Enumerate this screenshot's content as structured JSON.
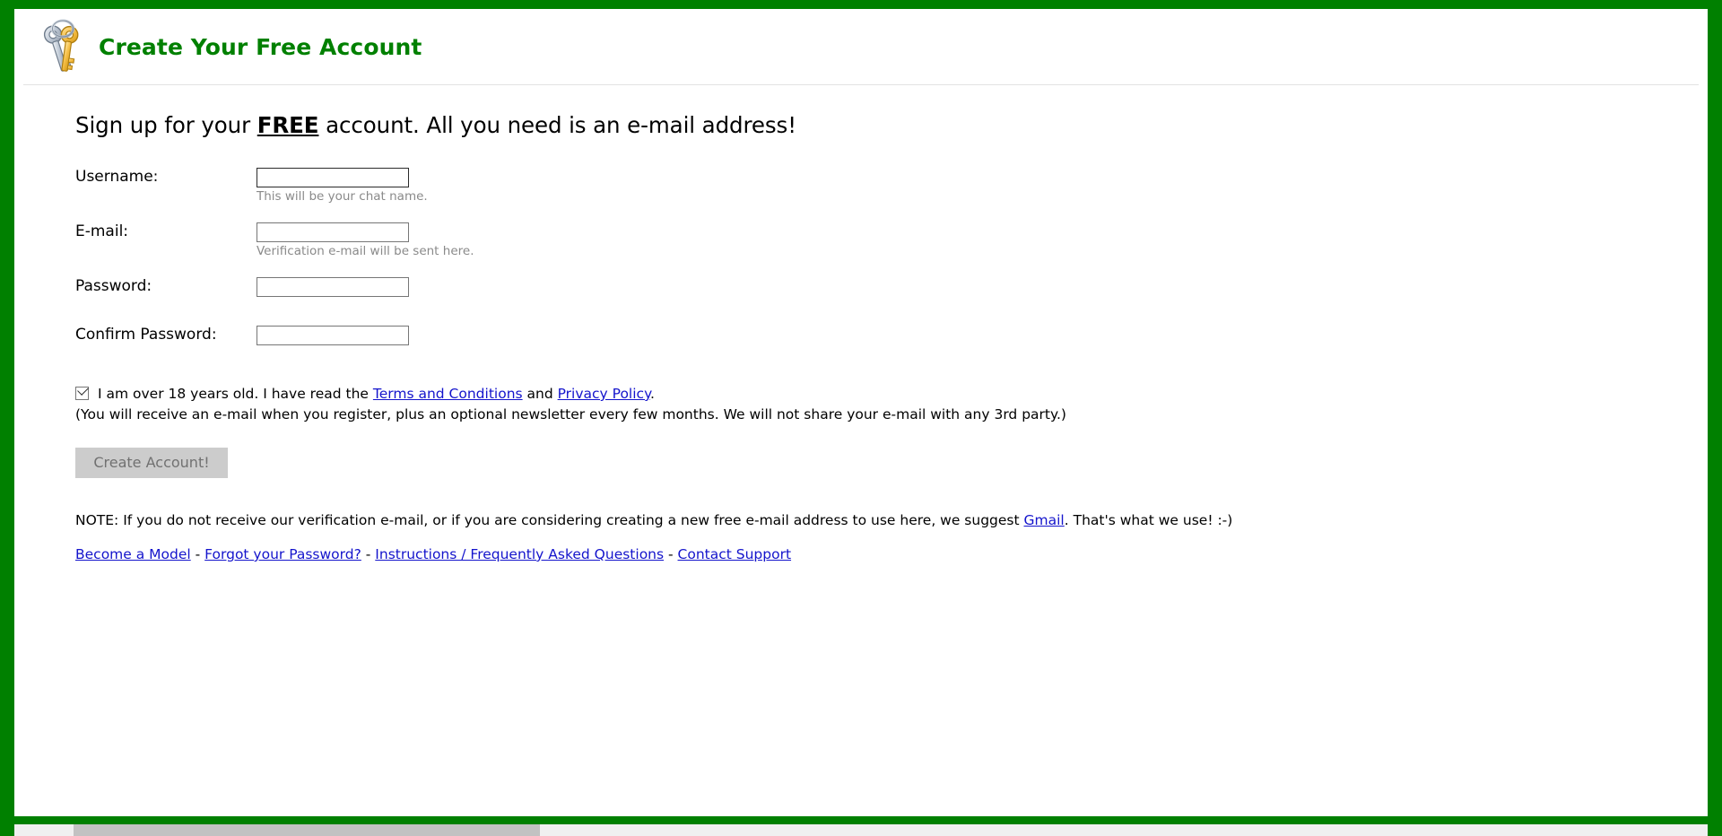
{
  "page": {
    "title": "Create Your Free Account",
    "header_icon": "keys-icon",
    "accent_color": "#008000",
    "link_color": "#1414CC",
    "frame_color": "#008000"
  },
  "tagline": {
    "before": "Sign up for your ",
    "emphasis": "FREE",
    "after": " account.  All you need is an e-mail address!"
  },
  "form": {
    "fields": [
      {
        "label": "Username:",
        "value": "",
        "placeholder": "",
        "hint": "This will be your chat name.",
        "focused": true,
        "name": "username"
      },
      {
        "label": "E-mail:",
        "value": "",
        "placeholder": "",
        "hint": "Verification e-mail will be sent here.",
        "focused": false,
        "name": "email"
      },
      {
        "label": "Password:",
        "value": "",
        "placeholder": "",
        "hint": "",
        "focused": false,
        "name": "password"
      },
      {
        "label": "Confirm Password:",
        "value": "",
        "placeholder": "",
        "hint": "",
        "focused": false,
        "name": "confirm-password"
      }
    ]
  },
  "terms": {
    "checked": true,
    "checkbox_icon": "checkmark-icon",
    "text_part1": "I am over 18 years old. I have read the ",
    "link_terms": "Terms and Conditions",
    "text_part2": " and ",
    "link_privacy": "Privacy Policy",
    "text_part3": ".",
    "disclaimer": "(You will receive an e-mail when you register, plus an optional newsletter every few months. We will not share your e-mail with any 3rd party.)"
  },
  "submit": {
    "label": "Create Account!",
    "enabled": false
  },
  "note": {
    "text_before": "NOTE: If you do not receive our verification e-mail, or if you are considering creating a new free e-mail address to use here, we suggest ",
    "link_gmail": "Gmail",
    "text_after": ".  That's what we use! :-)"
  },
  "footer": {
    "separator": " - ",
    "links": [
      "Become a Model",
      "Forgot your Password?",
      "Instructions / Frequently Asked Questions",
      "Contact Support"
    ]
  }
}
